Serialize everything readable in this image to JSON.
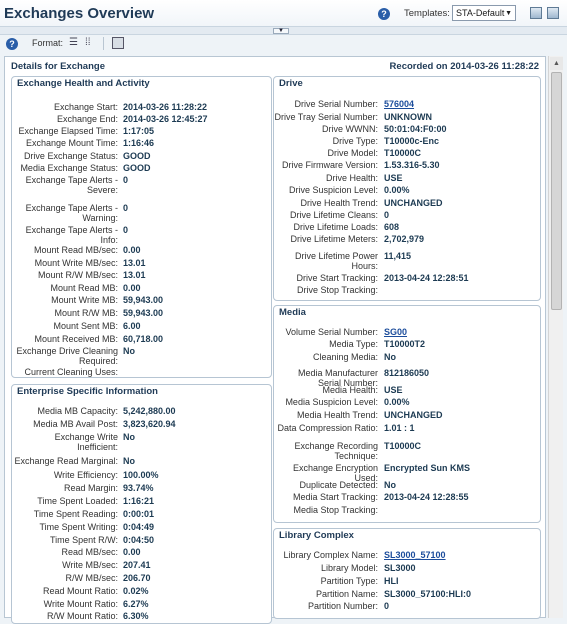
{
  "header": {
    "title": "Exchanges Overview",
    "templates_label": "Templates:",
    "templates_value": "STA-Default"
  },
  "toolbar": {
    "format_label": "Format:"
  },
  "main": {
    "title": "Details for Exchange",
    "recorded": "Recorded on 2014-03-26 11:28:22"
  },
  "exchange": {
    "title": "Exchange Health and Activity",
    "rows": [
      {
        "label": "Exchange Start:",
        "value": "2014-03-26 11:28:22"
      },
      {
        "label": "Exchange End:",
        "value": "2014-03-26 12:45:27"
      },
      {
        "label": "Exchange Elapsed Time:",
        "value": "1:17:05"
      },
      {
        "label": "Exchange Mount Time:",
        "value": "1:16:46"
      },
      {
        "label": "Drive Exchange Status:",
        "value": "GOOD"
      },
      {
        "label": "Media Exchange Status:",
        "value": "GOOD"
      },
      {
        "label": "Exchange Tape Alerts - Severe:",
        "value": "0"
      },
      {
        "label": "Exchange Tape Alerts - Warning:",
        "value": "0"
      },
      {
        "label": "Exchange Tape Alerts - Info:",
        "value": "0"
      },
      {
        "label": "Mount Read MB/sec:",
        "value": "0.00"
      },
      {
        "label": "Mount Write MB/sec:",
        "value": "13.01"
      },
      {
        "label": "Mount R/W MB/sec:",
        "value": "13.01"
      },
      {
        "label": "Mount Read MB:",
        "value": "0.00"
      },
      {
        "label": "Mount Write MB:",
        "value": "59,943.00"
      },
      {
        "label": "Mount R/W MB:",
        "value": "59,943.00"
      },
      {
        "label": "Mount Sent MB:",
        "value": "6.00"
      },
      {
        "label": "Mount Received MB:",
        "value": "60,718.00"
      },
      {
        "label": "Exchange Drive Cleaning Required:",
        "value": "No"
      },
      {
        "label": "Current Cleaning Uses:",
        "value": ""
      }
    ]
  },
  "enterprise": {
    "title": "Enterprise Specific Information",
    "rows": [
      {
        "label": "Media MB Capacity:",
        "value": "5,242,880.00"
      },
      {
        "label": "Media MB Avail Post:",
        "value": "3,823,620.94"
      },
      {
        "label": "Exchange Write Inefficient:",
        "value": "No"
      },
      {
        "label": "Exchange Read Marginal:",
        "value": "No"
      },
      {
        "label": "Write Efficiency:",
        "value": "100.00%"
      },
      {
        "label": "Read Margin:",
        "value": "93.74%"
      },
      {
        "label": "Time Spent Loaded:",
        "value": "1:16:21"
      },
      {
        "label": "Time Spent Reading:",
        "value": "0:00:01"
      },
      {
        "label": "Time Spent Writing:",
        "value": "0:04:49"
      },
      {
        "label": "Time Spent R/W:",
        "value": "0:04:50"
      },
      {
        "label": "Read MB/sec:",
        "value": "0.00"
      },
      {
        "label": "Write MB/sec:",
        "value": "207.41"
      },
      {
        "label": "R/W MB/sec:",
        "value": "206.70"
      },
      {
        "label": "Read Mount Ratio:",
        "value": "0.02%"
      },
      {
        "label": "Write Mount Ratio:",
        "value": "6.27%"
      },
      {
        "label": "R/W Mount Ratio:",
        "value": "6.30%"
      }
    ]
  },
  "drive": {
    "title": "Drive",
    "rows": [
      {
        "label": "Drive Serial Number:",
        "value": "576004",
        "link": true
      },
      {
        "label": "Drive Tray Serial Number:",
        "value": "UNKNOWN"
      },
      {
        "label": "Drive WWNN:",
        "value": "50:01:04:F0:00"
      },
      {
        "label": "Drive Type:",
        "value": "T10000c-Enc"
      },
      {
        "label": "Drive Model:",
        "value": "T10000C"
      },
      {
        "label": "Drive Firmware Version:",
        "value": "1.53.316-5.30"
      },
      {
        "label": "Drive Health:",
        "value": "USE"
      },
      {
        "label": "Drive Suspicion Level:",
        "value": "0.00%"
      },
      {
        "label": "Drive Health Trend:",
        "value": "UNCHANGED"
      },
      {
        "label": "Drive Lifetime Cleans:",
        "value": "0"
      },
      {
        "label": "Drive Lifetime Loads:",
        "value": "608"
      },
      {
        "label": "Drive Lifetime Meters:",
        "value": "2,702,979"
      },
      {
        "label": "Drive Lifetime Power Hours:",
        "value": "11,415"
      },
      {
        "label": "Drive Start Tracking:",
        "value": "2013-04-24 12:28:51"
      },
      {
        "label": "Drive Stop Tracking:",
        "value": ""
      }
    ]
  },
  "media": {
    "title": "Media",
    "rows": [
      {
        "label": "Volume Serial Number:",
        "value": "SG00",
        "link": true
      },
      {
        "label": "Media Type:",
        "value": "T10000T2"
      },
      {
        "label": "Cleaning Media:",
        "value": "No"
      },
      {
        "label": "Media Manufacturer Serial Number:",
        "value": "812186050"
      },
      {
        "label": "Media Health:",
        "value": "USE"
      },
      {
        "label": "Media Suspicion Level:",
        "value": "0.00%"
      },
      {
        "label": "Media Health Trend:",
        "value": "UNCHANGED"
      },
      {
        "label": "Data Compression Ratio:",
        "value": "1.01 : 1"
      },
      {
        "label": "Exchange Recording Technique:",
        "value": "T10000C"
      },
      {
        "label": "Exchange Encryption Used:",
        "value": "Encrypted Sun KMS"
      },
      {
        "label": "Duplicate Detected:",
        "value": "No"
      },
      {
        "label": "Media Start Tracking:",
        "value": "2013-04-24 12:28:55"
      },
      {
        "label": "Media Stop Tracking:",
        "value": ""
      }
    ]
  },
  "library": {
    "title": "Library Complex",
    "rows": [
      {
        "label": "Library Complex Name:",
        "value": "SL3000_57100",
        "link": true
      },
      {
        "label": "Library Model:",
        "value": "SL3000"
      },
      {
        "label": "Partition Type:",
        "value": "HLI"
      },
      {
        "label": "Partition Name:",
        "value": "SL3000_57100:HLI:0"
      },
      {
        "label": "Partition Number:",
        "value": "0"
      }
    ]
  }
}
